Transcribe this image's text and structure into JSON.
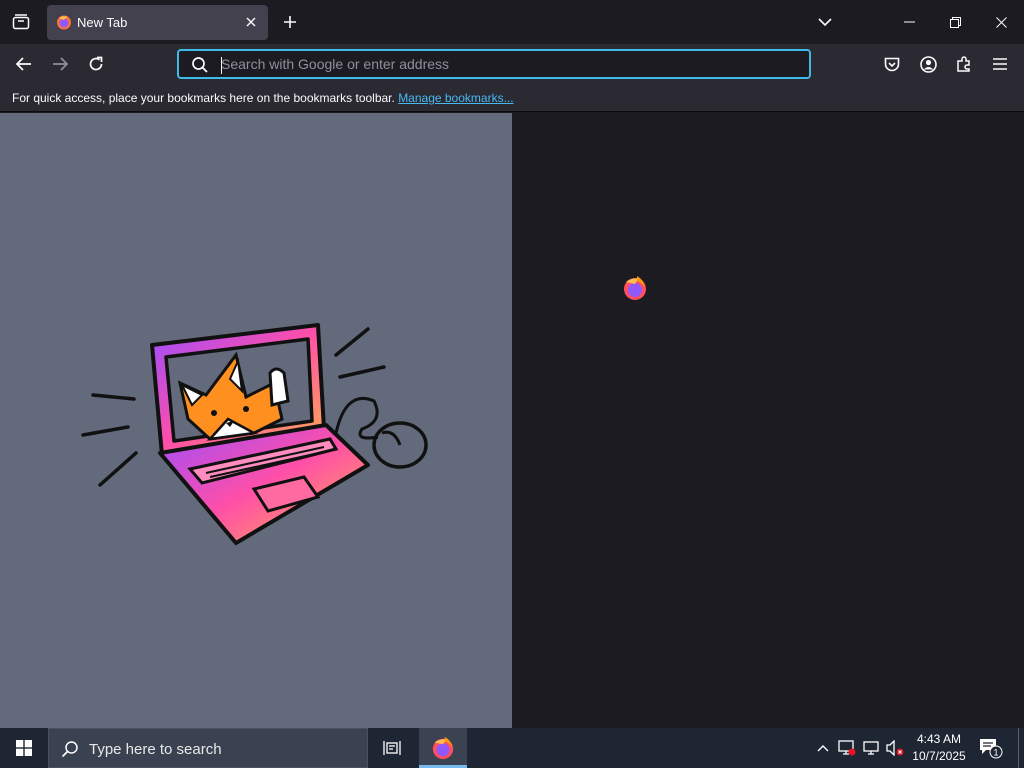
{
  "tabstrip": {
    "tab_title": "New Tab"
  },
  "urlbar": {
    "placeholder": "Search with Google or enter address",
    "value": ""
  },
  "bookmarks": {
    "message": "For quick access, place your bookmarks here on the bookmarks toolbar. ",
    "link": "Manage bookmarks..."
  },
  "taskbar": {
    "search_placeholder": "Type here to search",
    "time": "4:43 AM",
    "date": "10/7/2025",
    "notification_count": "1"
  },
  "colors": {
    "accent": "#3fb9e6",
    "link": "#47b9f1",
    "tab_active": "#42414d",
    "toolbar": "#2b2a33",
    "content_bg": "#1c1b22",
    "illustration_bg": "#626a7b"
  },
  "icons": [
    "tab-list-icon",
    "firefox-icon",
    "close-icon",
    "plus-icon",
    "chevron-down-icon",
    "minimize-icon",
    "restore-icon",
    "back-icon",
    "forward-icon",
    "reload-icon",
    "search-icon",
    "pocket-icon",
    "account-icon",
    "extensions-icon",
    "menu-icon",
    "windows-icon",
    "task-view-icon",
    "chevron-up-icon",
    "network-icon",
    "volume-muted-icon",
    "notifications-icon"
  ]
}
